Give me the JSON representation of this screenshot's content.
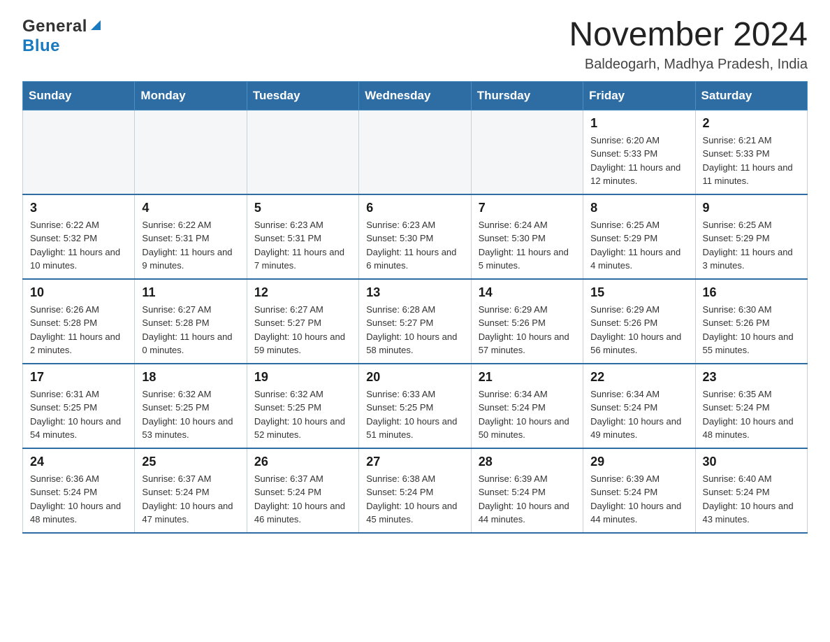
{
  "logo": {
    "general": "General",
    "blue": "Blue"
  },
  "header": {
    "title": "November 2024",
    "location": "Baldeogarh, Madhya Pradesh, India"
  },
  "days_of_week": [
    "Sunday",
    "Monday",
    "Tuesday",
    "Wednesday",
    "Thursday",
    "Friday",
    "Saturday"
  ],
  "weeks": [
    [
      {
        "day": "",
        "info": ""
      },
      {
        "day": "",
        "info": ""
      },
      {
        "day": "",
        "info": ""
      },
      {
        "day": "",
        "info": ""
      },
      {
        "day": "",
        "info": ""
      },
      {
        "day": "1",
        "info": "Sunrise: 6:20 AM\nSunset: 5:33 PM\nDaylight: 11 hours and 12 minutes."
      },
      {
        "day": "2",
        "info": "Sunrise: 6:21 AM\nSunset: 5:33 PM\nDaylight: 11 hours and 11 minutes."
      }
    ],
    [
      {
        "day": "3",
        "info": "Sunrise: 6:22 AM\nSunset: 5:32 PM\nDaylight: 11 hours and 10 minutes."
      },
      {
        "day": "4",
        "info": "Sunrise: 6:22 AM\nSunset: 5:31 PM\nDaylight: 11 hours and 9 minutes."
      },
      {
        "day": "5",
        "info": "Sunrise: 6:23 AM\nSunset: 5:31 PM\nDaylight: 11 hours and 7 minutes."
      },
      {
        "day": "6",
        "info": "Sunrise: 6:23 AM\nSunset: 5:30 PM\nDaylight: 11 hours and 6 minutes."
      },
      {
        "day": "7",
        "info": "Sunrise: 6:24 AM\nSunset: 5:30 PM\nDaylight: 11 hours and 5 minutes."
      },
      {
        "day": "8",
        "info": "Sunrise: 6:25 AM\nSunset: 5:29 PM\nDaylight: 11 hours and 4 minutes."
      },
      {
        "day": "9",
        "info": "Sunrise: 6:25 AM\nSunset: 5:29 PM\nDaylight: 11 hours and 3 minutes."
      }
    ],
    [
      {
        "day": "10",
        "info": "Sunrise: 6:26 AM\nSunset: 5:28 PM\nDaylight: 11 hours and 2 minutes."
      },
      {
        "day": "11",
        "info": "Sunrise: 6:27 AM\nSunset: 5:28 PM\nDaylight: 11 hours and 0 minutes."
      },
      {
        "day": "12",
        "info": "Sunrise: 6:27 AM\nSunset: 5:27 PM\nDaylight: 10 hours and 59 minutes."
      },
      {
        "day": "13",
        "info": "Sunrise: 6:28 AM\nSunset: 5:27 PM\nDaylight: 10 hours and 58 minutes."
      },
      {
        "day": "14",
        "info": "Sunrise: 6:29 AM\nSunset: 5:26 PM\nDaylight: 10 hours and 57 minutes."
      },
      {
        "day": "15",
        "info": "Sunrise: 6:29 AM\nSunset: 5:26 PM\nDaylight: 10 hours and 56 minutes."
      },
      {
        "day": "16",
        "info": "Sunrise: 6:30 AM\nSunset: 5:26 PM\nDaylight: 10 hours and 55 minutes."
      }
    ],
    [
      {
        "day": "17",
        "info": "Sunrise: 6:31 AM\nSunset: 5:25 PM\nDaylight: 10 hours and 54 minutes."
      },
      {
        "day": "18",
        "info": "Sunrise: 6:32 AM\nSunset: 5:25 PM\nDaylight: 10 hours and 53 minutes."
      },
      {
        "day": "19",
        "info": "Sunrise: 6:32 AM\nSunset: 5:25 PM\nDaylight: 10 hours and 52 minutes."
      },
      {
        "day": "20",
        "info": "Sunrise: 6:33 AM\nSunset: 5:25 PM\nDaylight: 10 hours and 51 minutes."
      },
      {
        "day": "21",
        "info": "Sunrise: 6:34 AM\nSunset: 5:24 PM\nDaylight: 10 hours and 50 minutes."
      },
      {
        "day": "22",
        "info": "Sunrise: 6:34 AM\nSunset: 5:24 PM\nDaylight: 10 hours and 49 minutes."
      },
      {
        "day": "23",
        "info": "Sunrise: 6:35 AM\nSunset: 5:24 PM\nDaylight: 10 hours and 48 minutes."
      }
    ],
    [
      {
        "day": "24",
        "info": "Sunrise: 6:36 AM\nSunset: 5:24 PM\nDaylight: 10 hours and 48 minutes."
      },
      {
        "day": "25",
        "info": "Sunrise: 6:37 AM\nSunset: 5:24 PM\nDaylight: 10 hours and 47 minutes."
      },
      {
        "day": "26",
        "info": "Sunrise: 6:37 AM\nSunset: 5:24 PM\nDaylight: 10 hours and 46 minutes."
      },
      {
        "day": "27",
        "info": "Sunrise: 6:38 AM\nSunset: 5:24 PM\nDaylight: 10 hours and 45 minutes."
      },
      {
        "day": "28",
        "info": "Sunrise: 6:39 AM\nSunset: 5:24 PM\nDaylight: 10 hours and 44 minutes."
      },
      {
        "day": "29",
        "info": "Sunrise: 6:39 AM\nSunset: 5:24 PM\nDaylight: 10 hours and 44 minutes."
      },
      {
        "day": "30",
        "info": "Sunrise: 6:40 AM\nSunset: 5:24 PM\nDaylight: 10 hours and 43 minutes."
      }
    ]
  ]
}
